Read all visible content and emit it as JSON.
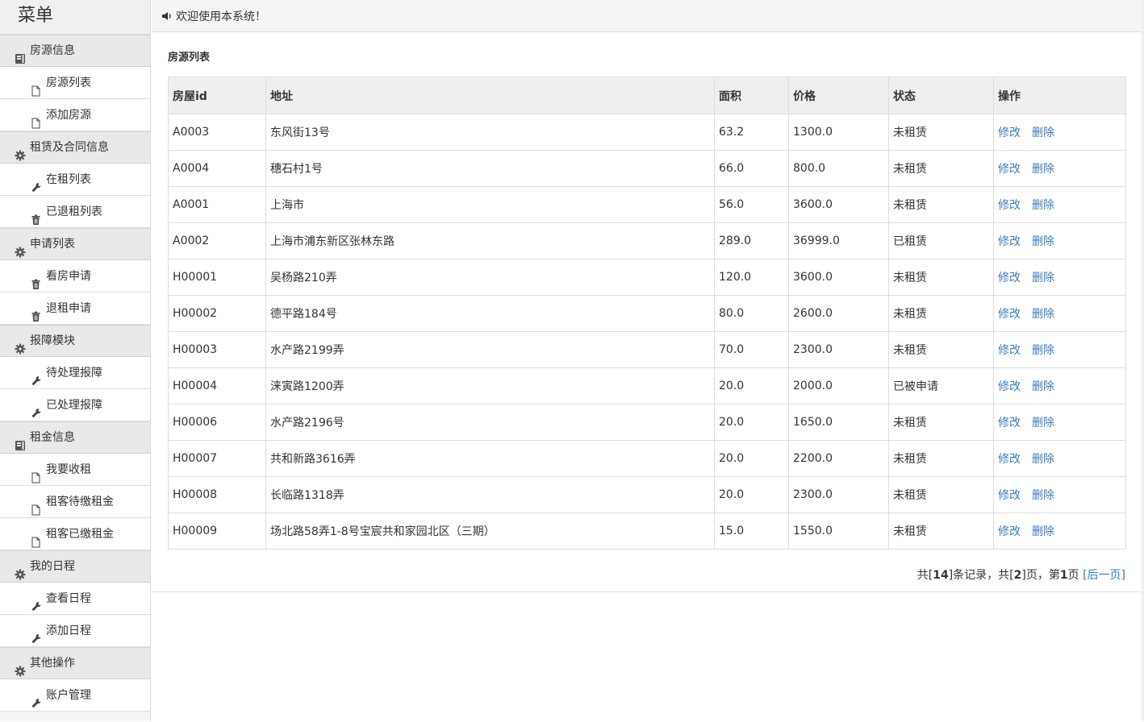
{
  "sidebar": {
    "title": "菜单",
    "groups": [
      {
        "label": "房源信息",
        "icon": "book-icon",
        "items": [
          {
            "label": "房源列表",
            "icon": "file-icon"
          },
          {
            "label": "添加房源",
            "icon": "file-icon"
          }
        ]
      },
      {
        "label": "租赁及合同信息",
        "icon": "gear-icon",
        "items": [
          {
            "label": "在租列表",
            "icon": "wrench-icon"
          },
          {
            "label": "已退租列表",
            "icon": "trash-icon"
          }
        ]
      },
      {
        "label": "申请列表",
        "icon": "gear-icon",
        "items": [
          {
            "label": "看房申请",
            "icon": "trash-icon"
          },
          {
            "label": "退租申请",
            "icon": "trash-icon"
          }
        ]
      },
      {
        "label": "报障模块",
        "icon": "gear-icon",
        "items": [
          {
            "label": "待处理报障",
            "icon": "wrench-icon"
          },
          {
            "label": "已处理报障",
            "icon": "wrench-icon"
          }
        ]
      },
      {
        "label": "租金信息",
        "icon": "book-icon",
        "items": [
          {
            "label": "我要收租",
            "icon": "file-icon"
          },
          {
            "label": "租客待缴租金",
            "icon": "file-icon"
          },
          {
            "label": "租客已缴租金",
            "icon": "file-icon"
          }
        ]
      },
      {
        "label": "我的日程",
        "icon": "gear-icon",
        "items": [
          {
            "label": "查看日程",
            "icon": "wrench-icon"
          },
          {
            "label": "添加日程",
            "icon": "wrench-icon"
          }
        ]
      },
      {
        "label": "其他操作",
        "icon": "gear-icon",
        "items": [
          {
            "label": "账户管理",
            "icon": "wrench-icon"
          }
        ]
      }
    ]
  },
  "topbar": {
    "welcome": "欢迎使用本系统！",
    "icon": "speaker-icon"
  },
  "main": {
    "title": "房源列表",
    "columns": [
      "房屋id",
      "地址",
      "面积",
      "价格",
      "状态",
      "操作"
    ],
    "rows": [
      {
        "id": "A0003",
        "addr": "东风街13号",
        "area": "63.2",
        "price": "1300.0",
        "status": "未租赁",
        "st": "free"
      },
      {
        "id": "A0004",
        "addr": "穗石村1号",
        "area": "66.0",
        "price": "800.0",
        "status": "未租赁",
        "st": "free"
      },
      {
        "id": "A0001",
        "addr": "上海市",
        "area": "56.0",
        "price": "3600.0",
        "status": "未租赁",
        "st": "free"
      },
      {
        "id": "A0002",
        "addr": "上海市浦东新区张林东路",
        "area": "289.0",
        "price": "36999.0",
        "status": "已租赁",
        "st": "rented"
      },
      {
        "id": "H00001",
        "addr": "吴杨路210弄",
        "area": "120.0",
        "price": "3600.0",
        "status": "未租赁",
        "st": "free"
      },
      {
        "id": "H00002",
        "addr": "德平路184号",
        "area": "80.0",
        "price": "2600.0",
        "status": "未租赁",
        "st": "free"
      },
      {
        "id": "H00003",
        "addr": "水产路2199弄",
        "area": "70.0",
        "price": "2300.0",
        "status": "未租赁",
        "st": "free"
      },
      {
        "id": "H00004",
        "addr": "涞寅路1200弄",
        "area": "20.0",
        "price": "2000.0",
        "status": "已被申请",
        "st": "applied"
      },
      {
        "id": "H00006",
        "addr": "水产路2196号",
        "area": "20.0",
        "price": "1650.0",
        "status": "未租赁",
        "st": "free"
      },
      {
        "id": "H00007",
        "addr": "共和新路3616弄",
        "area": "20.0",
        "price": "2200.0",
        "status": "未租赁",
        "st": "free"
      },
      {
        "id": "H00008",
        "addr": "长临路1318弄",
        "area": "20.0",
        "price": "2300.0",
        "status": "未租赁",
        "st": "free"
      },
      {
        "id": "H00009",
        "addr": "场北路58弄1-8号宝宸共和家园北区（三期）",
        "area": "15.0",
        "price": "1550.0",
        "status": "未租赁",
        "st": "free"
      }
    ],
    "actions": {
      "edit": "修改",
      "delete": "删除"
    },
    "pager": {
      "p1": "共[",
      "total": "14",
      "p2": "]条记录，共[",
      "pages": "2",
      "p3": "]页，第",
      "current": "1",
      "p4": "页 ",
      "next": "[后一页]"
    }
  },
  "colors": {
    "link": "#3a7bbf",
    "rented": "#e00000",
    "applied": "#2a9a2a"
  }
}
